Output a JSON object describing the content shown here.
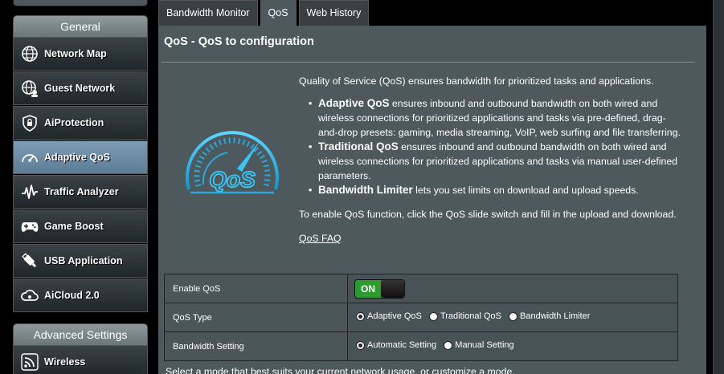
{
  "sidebar": {
    "general_header": "General",
    "advanced_header": "Advanced Settings",
    "items": [
      {
        "label": "Network Map",
        "icon": "network-map-icon"
      },
      {
        "label": "Guest Network",
        "icon": "guest-network-icon"
      },
      {
        "label": "AiProtection",
        "icon": "shield-icon"
      },
      {
        "label": "Adaptive QoS",
        "icon": "speedometer-icon",
        "active": true
      },
      {
        "label": "Traffic Analyzer",
        "icon": "traffic-wave-icon"
      },
      {
        "label": "Game Boost",
        "icon": "gamepad-icon"
      },
      {
        "label": "USB Application",
        "icon": "usb-icon"
      },
      {
        "label": "AiCloud 2.0",
        "icon": "cloud-icon"
      }
    ],
    "advanced_items": [
      {
        "label": "Wireless",
        "icon": "wireless-icon"
      }
    ]
  },
  "tabs": [
    {
      "label": "Bandwidth Monitor",
      "active": false
    },
    {
      "label": "QoS",
      "active": true
    },
    {
      "label": "Web History",
      "active": false
    }
  ],
  "page": {
    "title": "QoS - QoS to configuration",
    "intro": "Quality of Service (QoS) ensures bandwidth for prioritized tasks and applications.",
    "bullets": [
      {
        "term": "Adaptive QoS",
        "text": " ensures inbound and outbound bandwidth on both wired and wireless connections for prioritized applications and tasks via pre-defined, drag-and-drop presets: gaming, media streaming, VoIP, web surfing and file transferring."
      },
      {
        "term": "Traditional QoS",
        "text": " ensures inbound and outbound bandwidth on both wired and wireless connections for prioritized applications and tasks via manual user-defined parameters."
      },
      {
        "term": "Bandwidth Limiter",
        "text": " lets you set limits on download and upload speeds."
      }
    ],
    "enable_note": "To enable QoS function, click the QoS slide switch and fill in the upload and download.",
    "faq_link": "QoS FAQ",
    "gauge_text": "QoS"
  },
  "settings": {
    "enable_qos": {
      "label": "Enable QoS",
      "state": "ON"
    },
    "qos_type": {
      "label": "QoS Type",
      "options": [
        "Adaptive QoS",
        "Traditional QoS",
        "Bandwidth Limiter"
      ],
      "selected": "Adaptive QoS"
    },
    "bandwidth_setting": {
      "label": "Bandwidth Setting",
      "options": [
        "Automatic Setting",
        "Manual Setting"
      ],
      "selected": "Automatic Setting"
    }
  },
  "footer_text": "Select a mode that best suits your current network usage, or customize a mode.",
  "colors": {
    "panel": "#4d595d",
    "active_item": "#6d8ea6",
    "toggle_on": "#2d9b2d",
    "gauge": "#21b4e8"
  }
}
